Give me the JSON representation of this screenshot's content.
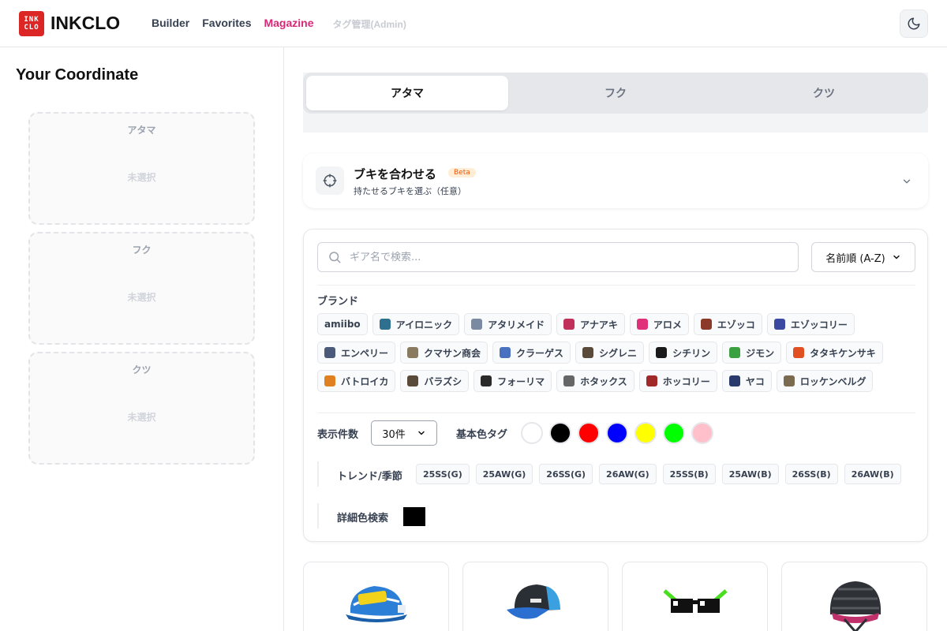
{
  "app": {
    "logo_line1": "INK",
    "logo_line2": "CLO",
    "name": "INKCLO"
  },
  "nav": {
    "builder": "Builder",
    "favorites": "Favorites",
    "magazine": "Magazine",
    "admin": "タグ管理(Admin)"
  },
  "coordinate": {
    "title": "Your Coordinate",
    "slots": [
      {
        "label": "アタマ",
        "empty": "未選択"
      },
      {
        "label": "フク",
        "empty": "未選択"
      },
      {
        "label": "クツ",
        "empty": "未選択"
      }
    ]
  },
  "tabs": [
    "アタマ",
    "フク",
    "クツ"
  ],
  "weapon": {
    "title": "ブキを合わせる",
    "badge": "Beta",
    "subtitle": "持たせるブキを選ぶ（任意）"
  },
  "search": {
    "placeholder": "ギア名で検索..."
  },
  "sort": {
    "value": "名前順 (A-Z)"
  },
  "brand": {
    "label": "ブランド",
    "rows": [
      [
        "amiibo",
        "アイロニック",
        "アタリメイド",
        "アナアキ",
        "アロメ",
        "エゾッコ",
        "エゾッコリー"
      ],
      [
        "エンペリー",
        "クマサン商会",
        "クラーゲス",
        "シグレニ",
        "シチリン",
        "ジモン",
        "タタキケンサキ"
      ],
      [
        "バトロイカ",
        "バラズシ",
        "フォーリマ",
        "ホタックス",
        "ホッコリー",
        "ヤコ",
        "ロッケンベルグ"
      ]
    ],
    "colors": [
      [
        null,
        "#2f6f8f",
        "#7a8aa0",
        "#c0305a",
        "#e0307a",
        "#8b3a2a",
        "#3b4aa0"
      ],
      [
        "#4a5a78",
        "#8a7a60",
        "#4a70c0",
        "#5a4a3a",
        "#1a1a1a",
        "#3aa040",
        "#e05020"
      ],
      [
        "#e08020",
        "#5a4a3a",
        "#2a2a2a",
        "#666666",
        "#a02828",
        "#2a3a6a",
        "#7a6a50"
      ]
    ]
  },
  "display": {
    "count_label": "表示件数",
    "count_value": "30件",
    "color_tag_label": "基本色タグ"
  },
  "color_tags": [
    {
      "name": "white",
      "hex": "#ffffff"
    },
    {
      "name": "black",
      "hex": "#000000"
    },
    {
      "name": "red",
      "hex": "#ff0000"
    },
    {
      "name": "blue",
      "hex": "#0000ff"
    },
    {
      "name": "yellow",
      "hex": "#ffff00"
    },
    {
      "name": "green",
      "hex": "#00ff00"
    },
    {
      "name": "pink",
      "hex": "#ffc0cb"
    }
  ],
  "trend": {
    "label": "トレンド/季節",
    "seasons": [
      "25SS(G)",
      "25AW(G)",
      "26SS(G)",
      "26AW(G)",
      "25SS(B)",
      "25AW(B)",
      "26SS(B)",
      "26AW(B)"
    ]
  },
  "detail_color": {
    "label": "詳細色検索",
    "value": "#000000"
  },
  "accent": "#db2777"
}
